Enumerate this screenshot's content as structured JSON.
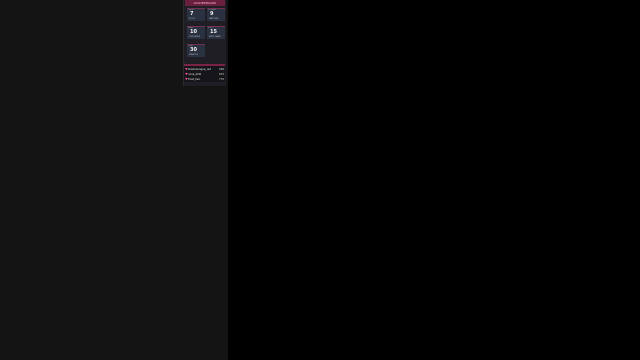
{
  "panel": {
    "header": "LEADERBOARD",
    "tiles": [
      {
        "tag": "LEVEL",
        "value": "7",
        "sub": "XP 18"
      },
      {
        "tag": "STREAK",
        "value": "9",
        "sub": "MATCHES"
      },
      {
        "tag": "WINS",
        "value": "10",
        "sub": "THIS WEEK"
      },
      {
        "tag": "KILLS",
        "value": "15",
        "sub": "BEST GAME"
      },
      {
        "tag": "TIME",
        "value": "30",
        "sub": "MINUTES"
      }
    ],
    "list": [
      {
        "name": "shadowrogue_red",
        "value": "999"
      },
      {
        "name": "nova_blitz",
        "value": "815"
      },
      {
        "name": "frost_hex",
        "value": "770"
      }
    ]
  }
}
